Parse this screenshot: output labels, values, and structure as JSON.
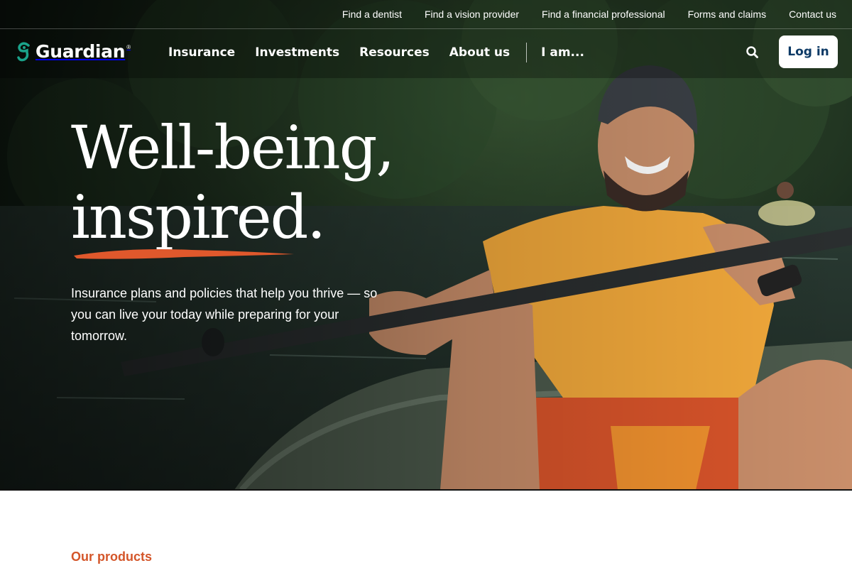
{
  "utility_bar": {
    "links": [
      "Find a dentist",
      "Find a vision provider",
      "Find a financial professional",
      "Forms and claims",
      "Contact us"
    ]
  },
  "brand": {
    "name": "Guardian",
    "trademark": "®",
    "logo_icon": "guardian-g-icon",
    "accent_color": "#1aa38a"
  },
  "nav": {
    "items": [
      "Insurance",
      "Investments",
      "Resources",
      "About us"
    ],
    "i_am": "I am...",
    "search_icon": "search-icon",
    "login_label": "Log in"
  },
  "hero": {
    "headline_line1": "Well-being,",
    "headline_line2": "inspired.",
    "subtext": "Insurance plans and policies that help you thrive — so you can live your today while preparing for your tomorrow.",
    "underline_color": "#e0582c"
  },
  "products": {
    "label": "Our products",
    "label_color": "#d4562a"
  }
}
